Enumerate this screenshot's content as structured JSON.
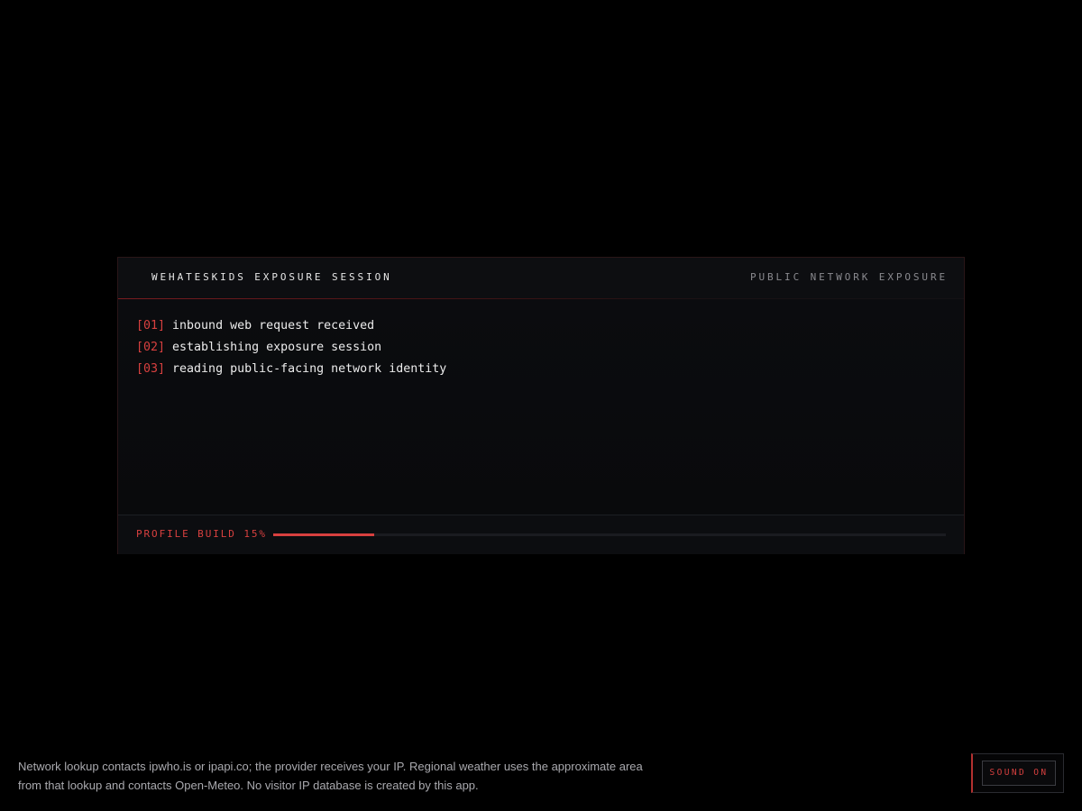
{
  "session": {
    "title": "WEHATESKIDS EXPOSURE SESSION",
    "subtitle": "PUBLIC NETWORK EXPOSURE",
    "log": [
      {
        "index": "[01]",
        "text": "inbound web request received"
      },
      {
        "index": "[02]",
        "text": "establishing exposure session"
      },
      {
        "index": "[03]",
        "text": "reading public-facing network identity"
      }
    ]
  },
  "progress": {
    "label": "PROFILE BUILD 15%",
    "value_percent": 15
  },
  "disclaimer": {
    "line1": "Network lookup contacts ipwho.is or ipapi.co; the provider receives your IP. Regional weather uses the approximate area",
    "line2": "from that lookup and contacts Open-Meteo. No visitor IP database is created by this app."
  },
  "sound_toggle": {
    "label": "SOUND ON"
  },
  "colors": {
    "accent": "#d8403f",
    "background": "#000000",
    "panel": "#0a0b0e"
  }
}
